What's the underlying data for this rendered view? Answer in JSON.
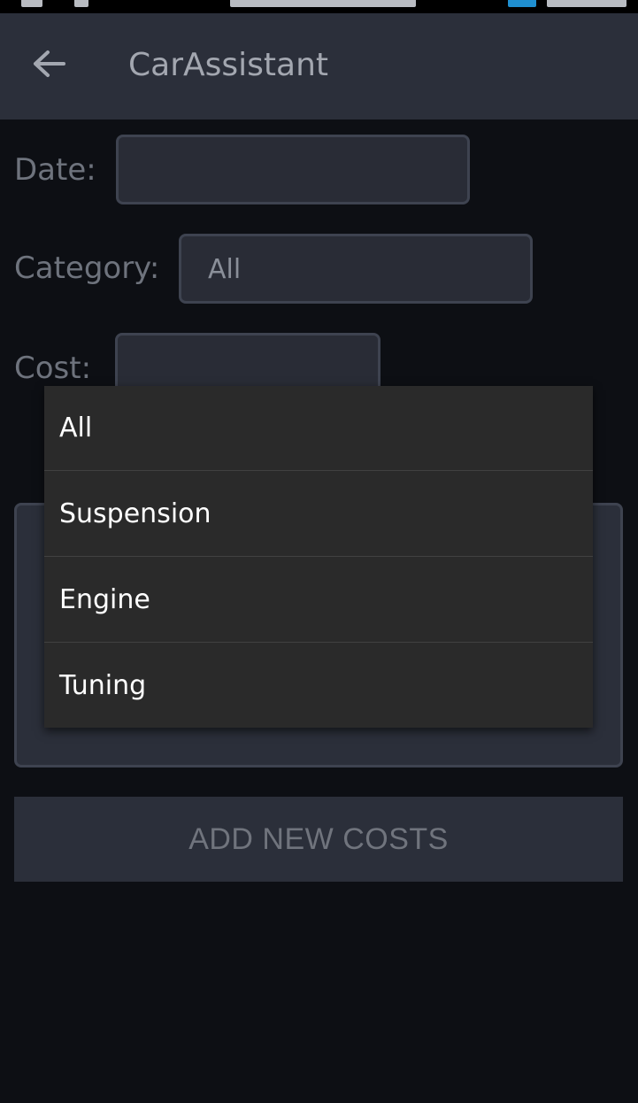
{
  "app": {
    "title": "CarAssistant"
  },
  "form": {
    "date_label": "Date:",
    "date_value": "",
    "category_label": "Category:",
    "category_value": "All",
    "cost_label": "Cost:",
    "cost_value": ""
  },
  "dropdown": {
    "options": [
      "All",
      "Suspension",
      "Engine",
      "Tuning"
    ]
  },
  "actions": {
    "add_label": "ADD NEW COSTS"
  },
  "colors": {
    "background": "#0d0f14",
    "appbar": "#2b2f3a",
    "field": "#292c36",
    "field_border": "#3e4350",
    "dropdown": "#2a2a2a"
  },
  "icons": {
    "back": "arrow-left-icon"
  }
}
